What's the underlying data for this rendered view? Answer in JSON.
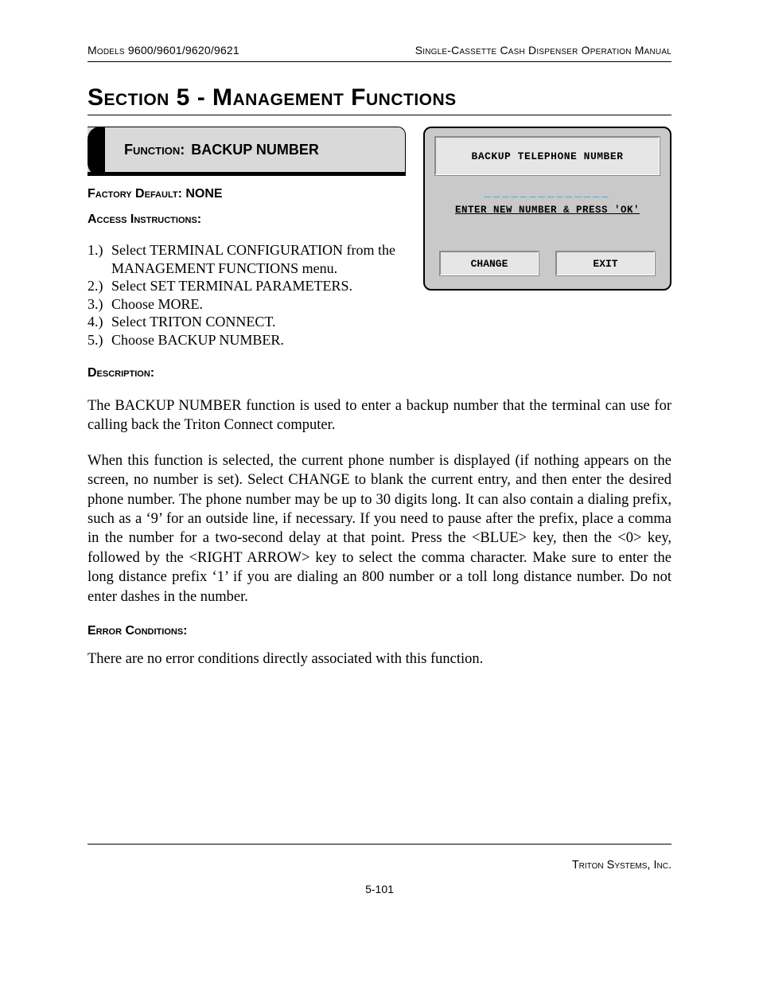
{
  "header": {
    "left": "Models 9600/9601/9620/9621",
    "right": "Single-Cassette Cash Dispenser Operation Manual"
  },
  "section_title": "Section 5 - Management Functions",
  "function": {
    "prefix": "Function:",
    "name": "BACKUP NUMBER"
  },
  "factory_default": {
    "label": "Factory Default:",
    "value": "NONE"
  },
  "access_label": "Access Instructions:",
  "access_steps": [
    {
      "num": "1.)",
      "text": "Select TERMINAL CONFIGURATION from the MANAGEMENT FUNCTIONS menu."
    },
    {
      "num": "2.)",
      "text": "Select SET TERMINAL PARAMETERS."
    },
    {
      "num": "3.)",
      "text": "Choose MORE."
    },
    {
      "num": "4.)",
      "text": "Select TRITON CONNECT."
    },
    {
      "num": "5.)",
      "text": "Choose BACKUP NUMBER."
    }
  ],
  "description_label": "Description:",
  "description_p1": "The BACKUP NUMBER function is used to enter a backup number that the terminal can use for calling back the Triton Connect computer.",
  "description_p2": "When this function is selected, the current phone number is displayed (if nothing appears on the screen, no number is set).  Select CHANGE to blank the current entry, and then enter the desired phone number.  The phone number may be up to 30 digits long.  It can also contain a dialing prefix, such as a ‘9’ for an outside line, if necessary.  If you need to pause after the prefix, place a comma in the number for a two-second delay at that point.  Press the <BLUE> key, then the <0> key, followed by the <RIGHT ARROW> key to select the comma character.  Make sure to enter the long distance prefix ‘1’ if you are dialing an 800 number or a toll long distance number.  Do not enter dashes in the number.",
  "error_label": "Error Conditions:",
  "error_text": "There are no error conditions directly associated with this function.",
  "screen": {
    "title": "BACKUP TELEPHONE NUMBER",
    "input_placeholder": "______________",
    "hint": "ENTER NEW NUMBER & PRESS 'OK'",
    "btn_change": "CHANGE",
    "btn_exit": "EXIT"
  },
  "footer": {
    "company": "Triton Systems, Inc.",
    "page_number": "5-101"
  }
}
